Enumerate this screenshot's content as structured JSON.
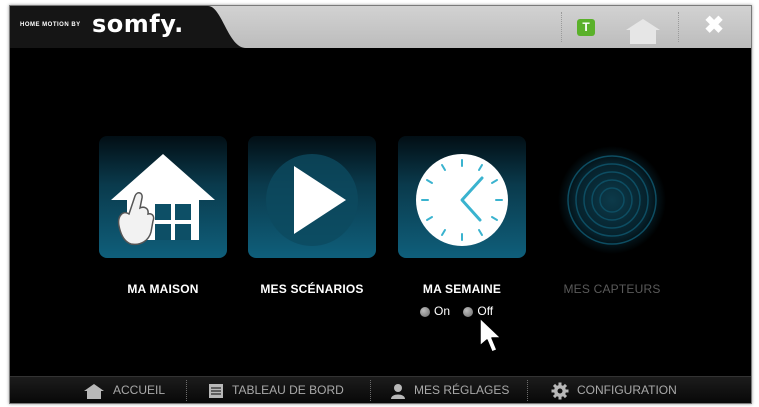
{
  "header": {
    "brand_prefix": "HOME MOTION BY",
    "brand_name": "somfy.",
    "t_badge": "T",
    "close_glyph": "✖"
  },
  "tiles": [
    {
      "label": "MA MAISON",
      "icon": "house-hand-icon"
    },
    {
      "label": "MES SCÉNARIOS",
      "icon": "play-icon"
    },
    {
      "label": "MA SEMAINE",
      "icon": "clock-icon"
    },
    {
      "label": "MES CAPTEURS",
      "icon": "sensor-icon"
    }
  ],
  "semaine_toggle": {
    "on_label": "On",
    "off_label": "Off"
  },
  "bottom_nav": [
    {
      "label": "ACCUEIL",
      "icon": "home-icon"
    },
    {
      "label": "TABLEAU DE BORD",
      "icon": "dashboard-icon"
    },
    {
      "label": "MES RÉGLAGES",
      "icon": "user-icon"
    },
    {
      "label": "CONFIGURATION",
      "icon": "gear-icon"
    }
  ],
  "colors": {
    "accent_green": "#5ab12a",
    "tile_teal": "#0f5f7b",
    "clock_hand": "#3ab3cf"
  }
}
